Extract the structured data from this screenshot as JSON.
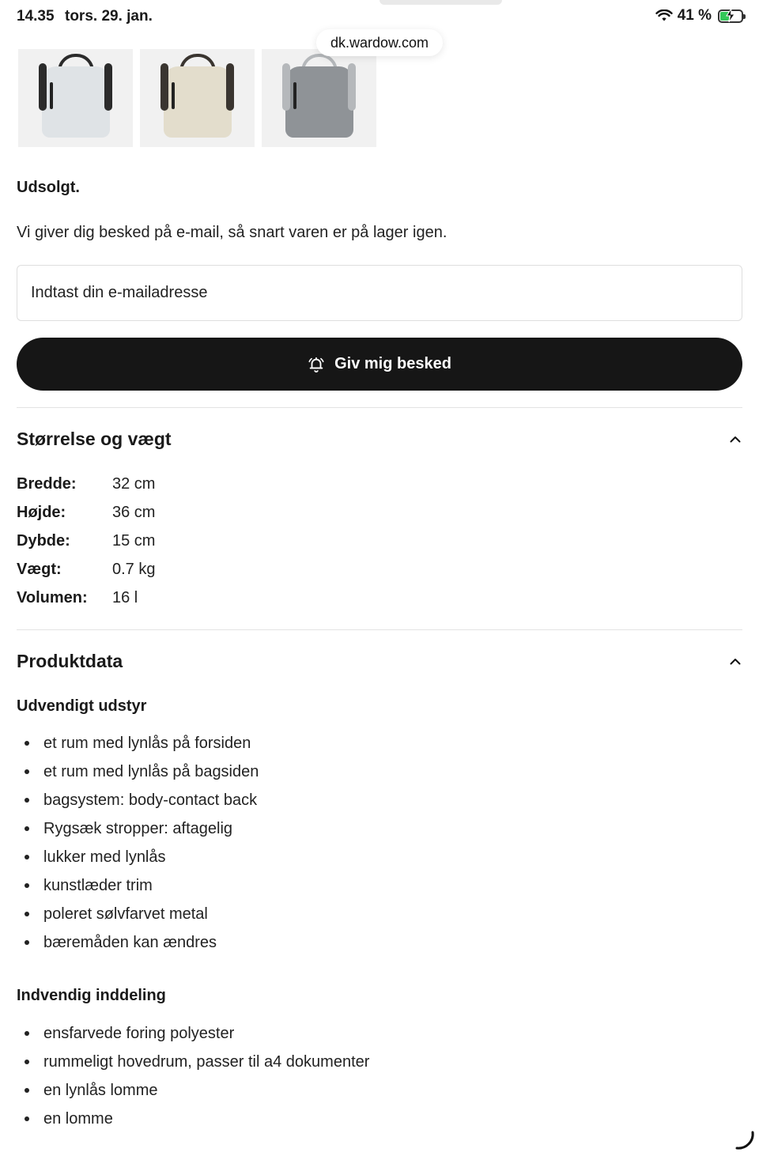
{
  "status": {
    "time": "14.35",
    "date": "tors. 29. jan.",
    "battery_pct": "41 %",
    "battery_level": 0.41
  },
  "browser": {
    "url": "dk.wardow.com"
  },
  "thumbnails": [
    {
      "name": "light-grey-bag",
      "color": "#dfe3e6",
      "strap": "#2b2b2b"
    },
    {
      "name": "beige-bag",
      "color": "#e3ddcc",
      "strap": "#3a3530"
    },
    {
      "name": "grey-bag",
      "color": "#8f9397",
      "strap": "#b5b8bb"
    }
  ],
  "stock": {
    "status": "Udsolgt.",
    "notice": "Vi giver dig besked på e-mail, så snart varen er på lager igen.",
    "email_placeholder": "Indtast din e-mailadresse",
    "notify_button": "Giv mig besked"
  },
  "size_section": {
    "title": "Størrelse og vægt",
    "rows": [
      {
        "label": "Bredde:",
        "value": "32 cm"
      },
      {
        "label": "Højde:",
        "value": "36 cm"
      },
      {
        "label": "Dybde:",
        "value": "15 cm"
      },
      {
        "label": "Vægt:",
        "value": "0.7 kg"
      },
      {
        "label": "Volumen:",
        "value": "16 l"
      }
    ]
  },
  "product_section": {
    "title": "Produktdata",
    "exterior_title": "Udvendigt udstyr",
    "exterior": [
      "et rum med lynlås på forsiden",
      "et rum med lynlås på bagsiden",
      "bagsystem: body-contact back",
      "Rygsæk stropper: aftagelig",
      "lukker med lynlås",
      "kunstlæder trim",
      "poleret sølvfarvet metal",
      "bæremåden kan ændres"
    ],
    "interior_title": "Indvendig inddeling",
    "interior": [
      "ensfarvede foring polyester",
      "rummeligt hovedrum, passer til a4 dokumenter",
      "en lynlås lomme",
      "en lomme"
    ]
  },
  "icons": {
    "wifi": "wifi-icon",
    "battery": "battery-icon",
    "bell": "bell-icon",
    "chevron": "chevron-up-icon",
    "spinner": "loading-spinner-icon"
  }
}
